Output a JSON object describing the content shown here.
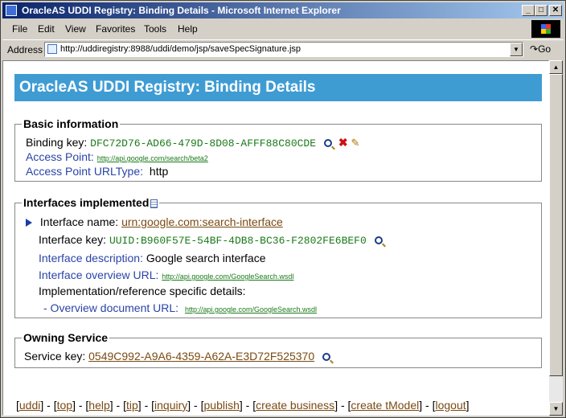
{
  "window": {
    "title": "OracleAS UDDI Registry: Binding Details - Microsoft Internet Explorer",
    "min": "_",
    "max": "□",
    "close": "✕"
  },
  "menu": {
    "file": "File",
    "edit": "Edit",
    "view": "View",
    "favorites": "Favorites",
    "tools": "Tools",
    "help": "Help"
  },
  "address": {
    "label": "Address",
    "url": "http://uddiregistry:8988/uddi/demo/jsp/saveSpecSignature.jsp",
    "go": "Go"
  },
  "page": {
    "heading": "OracleAS UDDI Registry: Binding Details",
    "basic": {
      "legend": "Basic information",
      "binding_key_label": "Binding key:",
      "binding_key": "DFC72D76-AD66-479D-8D08-AFFF88C80CDE",
      "access_point_label": "Access Point:",
      "access_point": "http://api.google.com/search/beta2",
      "url_type_label": "Access Point URLType:",
      "url_type": "http"
    },
    "interfaces": {
      "legend": "Interfaces implemented",
      "name_label": "Interface name:",
      "name": "urn:google.com:search-interface",
      "key_label": "Interface key:",
      "key": "UUID:B960F57E-54BF-4DB8-BC36-F2802FE6BEF0",
      "desc_label": "Interface description:",
      "desc": "Google search interface",
      "overview_label": "Interface overview URL:",
      "overview": "http://api.google.com/GoogleSearch.wsdl",
      "impl_label": "Implementation/reference specific details:",
      "doc_label": "- Overview document URL:",
      "doc": "http://api.google.com/GoogleSearch.wsdl"
    },
    "owning": {
      "legend": "Owning Service",
      "service_key_label": "Service key:",
      "service_key": "0549C992-A9A6-4359-A62A-E3D72F525370"
    },
    "footer": [
      "uddi",
      "top",
      "help",
      "tip",
      "inquiry",
      "publish",
      "create business",
      "create tModel",
      "logout"
    ]
  }
}
